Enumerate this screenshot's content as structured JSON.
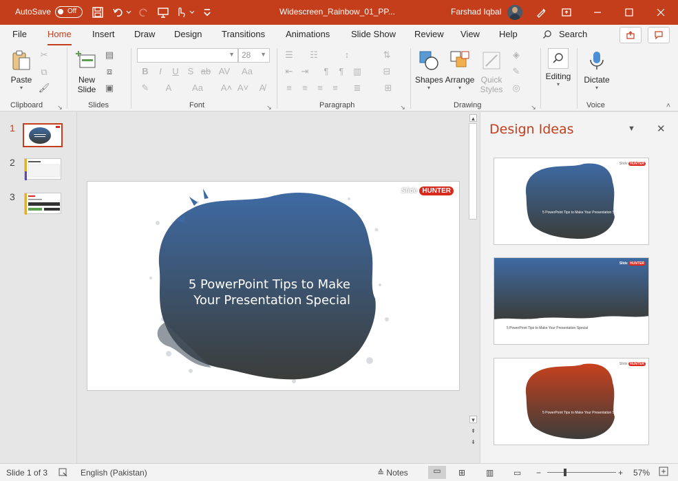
{
  "titlebar": {
    "autosave_label": "AutoSave",
    "autosave_state": "Off",
    "doc_title": "Widescreen_Rainbow_01_PP...",
    "user_name": "Farshad Iqbal",
    "bg_color": "#c43e1c"
  },
  "menu": {
    "tabs": [
      "File",
      "Home",
      "Insert",
      "Draw",
      "Design",
      "Transitions",
      "Animations",
      "Slide Show",
      "Review",
      "View",
      "Help"
    ],
    "active": "Home",
    "search_label": "Search"
  },
  "ribbon": {
    "clipboard": {
      "paste": "Paste",
      "label": "Clipboard"
    },
    "slides": {
      "new_slide_line1": "New",
      "new_slide_line2": "Slide",
      "label": "Slides"
    },
    "font": {
      "font_name": "",
      "font_size": "28",
      "label": "Font"
    },
    "paragraph": {
      "label": "Paragraph"
    },
    "drawing": {
      "shapes": "Shapes",
      "arrange": "Arrange",
      "quick_styles_line1": "Quick",
      "quick_styles_line2": "Styles",
      "label": "Drawing"
    },
    "editing": {
      "label_btn": "Editing"
    },
    "voice": {
      "dictate": "Dictate",
      "label": "Voice"
    }
  },
  "thumbnails": {
    "items": [
      {
        "number": "1",
        "selected": true
      },
      {
        "number": "2",
        "selected": false
      },
      {
        "number": "3",
        "selected": false
      }
    ]
  },
  "slide": {
    "title_line1": "5 PowerPoint Tips to Make",
    "title_line2": "Your Presentation Special",
    "brand_slide": "Slide",
    "brand_hunter": "HUNTER",
    "blob_top_color": "#3e6aa3",
    "blob_bottom_color": "#3b3d3a"
  },
  "design_ideas": {
    "title": "Design Ideas",
    "idea_text": "5 PowerPoint Tips to Make Your Presentation Special",
    "brand_slide": "Slide",
    "brand_hunter": "HUNTER",
    "accent_orange": "#c7401e"
  },
  "statusbar": {
    "slide_info": "Slide 1 of 3",
    "language": "English (Pakistan)",
    "notes": "Notes",
    "zoom": "57%"
  }
}
